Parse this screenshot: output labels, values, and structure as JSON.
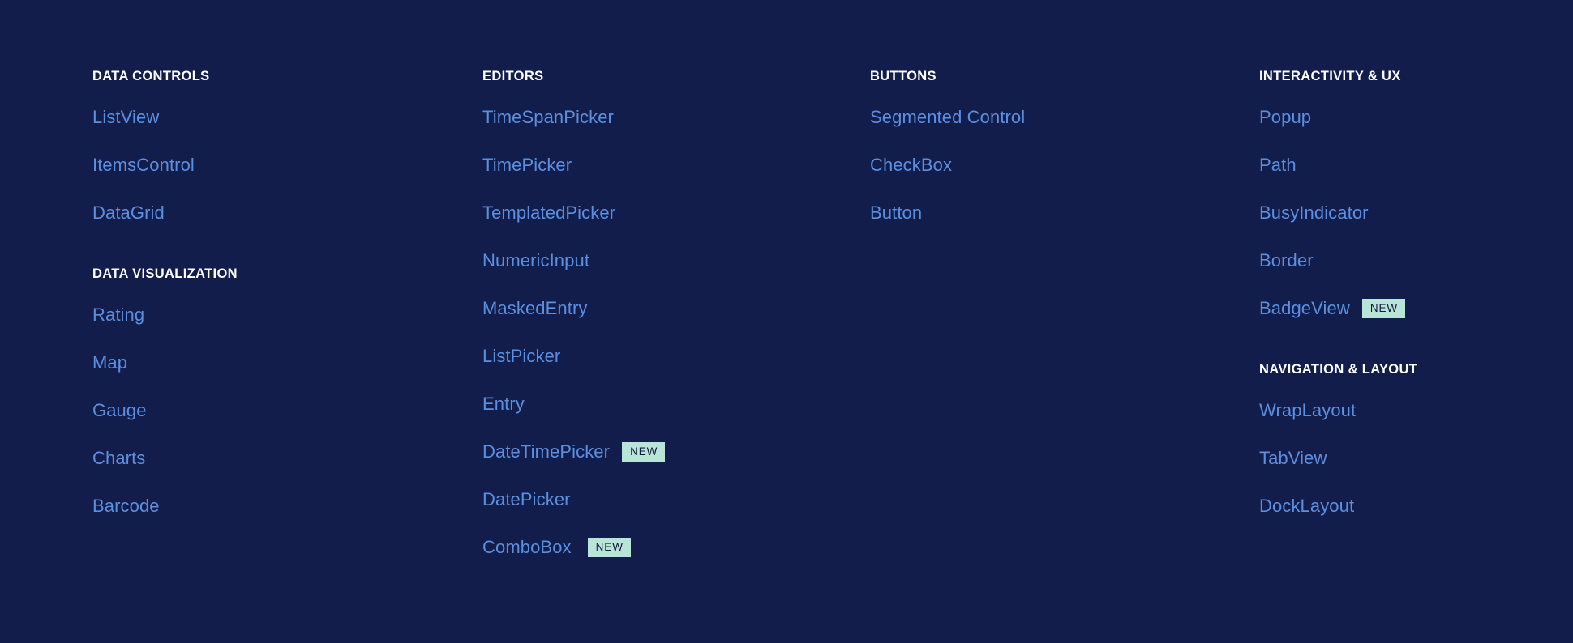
{
  "theme": {
    "background": "#131d4c",
    "link_color": "#5b8fe0",
    "heading_color": "#ffffff",
    "badge_background": "#b9e4d8",
    "badge_text_color": "#10193f"
  },
  "columns": [
    {
      "groups": [
        {
          "title": "DATA CONTROLS",
          "items": [
            {
              "label": "ListView",
              "badge": null
            },
            {
              "label": "ItemsControl",
              "badge": null
            },
            {
              "label": "DataGrid",
              "badge": null
            }
          ]
        },
        {
          "title": "DATA VISUALIZATION",
          "items": [
            {
              "label": "Rating",
              "badge": null
            },
            {
              "label": "Map",
              "badge": null
            },
            {
              "label": "Gauge",
              "badge": null
            },
            {
              "label": "Charts",
              "badge": null
            },
            {
              "label": "Barcode",
              "badge": null
            }
          ]
        }
      ]
    },
    {
      "groups": [
        {
          "title": "EDITORS",
          "items": [
            {
              "label": "TimeSpanPicker",
              "badge": null
            },
            {
              "label": "TimePicker",
              "badge": null
            },
            {
              "label": "TemplatedPicker",
              "badge": null
            },
            {
              "label": "NumericInput",
              "badge": null
            },
            {
              "label": "MaskedEntry",
              "badge": null
            },
            {
              "label": "ListPicker",
              "badge": null
            },
            {
              "label": "Entry",
              "badge": null
            },
            {
              "label": "DateTimePicker",
              "badge": "NEW"
            },
            {
              "label": "DatePicker",
              "badge": null
            },
            {
              "label": "ComboBox",
              "badge": "NEW"
            }
          ]
        }
      ]
    },
    {
      "groups": [
        {
          "title": "BUTTONS",
          "items": [
            {
              "label": "Segmented Control",
              "badge": null
            },
            {
              "label": "CheckBox",
              "badge": null
            },
            {
              "label": "Button",
              "badge": null
            }
          ]
        }
      ]
    },
    {
      "groups": [
        {
          "title": "INTERACTIVITY & UX",
          "items": [
            {
              "label": "Popup",
              "badge": null
            },
            {
              "label": "Path",
              "badge": null
            },
            {
              "label": "BusyIndicator",
              "badge": null
            },
            {
              "label": "Border",
              "badge": null
            },
            {
              "label": "BadgeView",
              "badge": "NEW"
            }
          ]
        },
        {
          "title": "NAVIGATION & LAYOUT",
          "items": [
            {
              "label": "WrapLayout",
              "badge": null
            },
            {
              "label": "TabView",
              "badge": null
            },
            {
              "label": "DockLayout",
              "badge": null
            }
          ]
        }
      ]
    }
  ]
}
